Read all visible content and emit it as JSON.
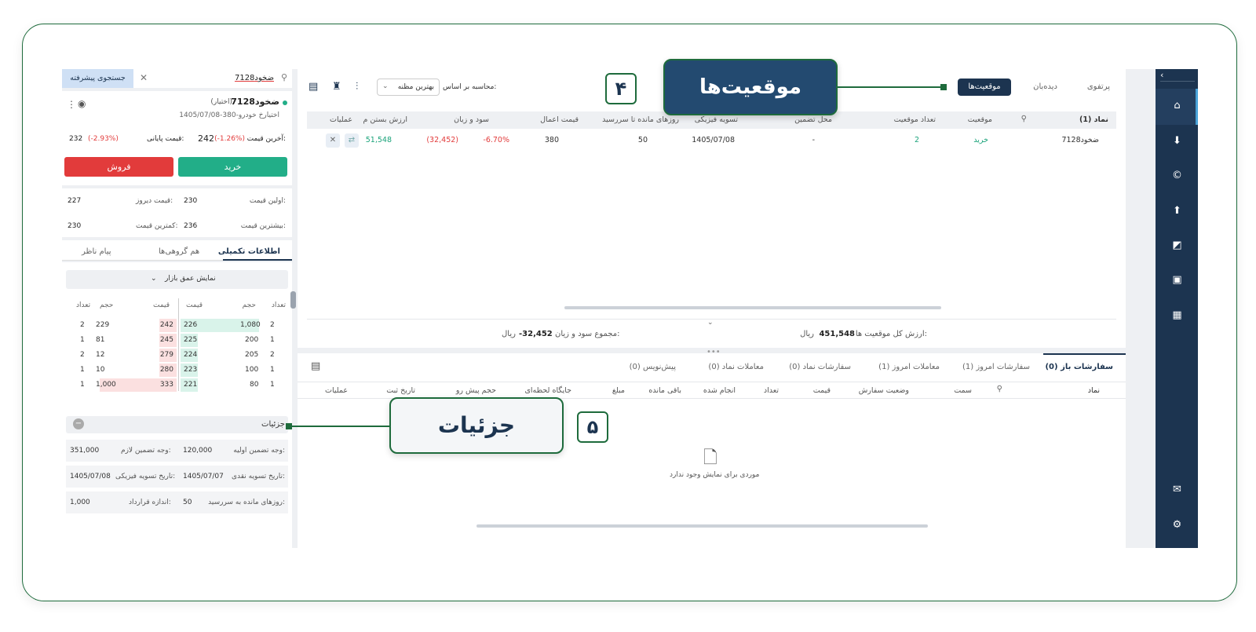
{
  "callouts": {
    "positions": {
      "number": "۴",
      "label": "موقعیت‌ها"
    },
    "details": {
      "number": "۵",
      "label": "جزئیات"
    }
  },
  "colors": {
    "rail": "#1c3450",
    "buy": "#22ae88",
    "sell": "#e23b3b",
    "accent": "#1e6b3c"
  },
  "left": {
    "advanced_search": "جستجوی پیشرفته",
    "search_value": "ضخود7128",
    "symbol": "ضخود7128",
    "symbol_type": "(اختیار)",
    "symbol_desc": "اختیارخ خودرو-380-1405/07/08",
    "last_price_label": "آخرین قیمت:",
    "last_price": "242",
    "last_price_change": "(-1.26%)",
    "close_price_label": "قیمت پایانی:",
    "close_price": "232",
    "close_price_change": "(-2.93%)",
    "buy": "خرید",
    "sell": "فروش",
    "first_price_label": "اولین قیمت:",
    "first_price": "230",
    "yesterday_price_label": "قیمت دیروز:",
    "yesterday_price": "227",
    "max_price_label": "بیشترین قیمت:",
    "max_price": "236",
    "min_price_label": "کمترین قیمت:",
    "min_price": "230",
    "tabs": [
      "اطلاعات تکمیلی",
      "هم گروهی‌ها",
      "پیام ناظر"
    ],
    "depth_toggle": "نمایش عمق بازار",
    "depth_headers": {
      "count": "تعداد",
      "volume": "حجم",
      "price": "قیمت"
    },
    "bids": [
      {
        "count": "2",
        "volume": "1,080",
        "price": "226"
      },
      {
        "count": "1",
        "volume": "200",
        "price": "225"
      },
      {
        "count": "2",
        "volume": "205",
        "price": "224"
      },
      {
        "count": "1",
        "volume": "100",
        "price": "223"
      },
      {
        "count": "1",
        "volume": "80",
        "price": "221"
      }
    ],
    "asks": [
      {
        "price": "242",
        "volume": "229",
        "count": "2"
      },
      {
        "price": "245",
        "volume": "81",
        "count": "1"
      },
      {
        "price": "279",
        "volume": "12",
        "count": "2"
      },
      {
        "price": "280",
        "volume": "10",
        "count": "1"
      },
      {
        "price": "333",
        "volume": "1,000",
        "count": "1"
      }
    ],
    "details_title": "جزئیات",
    "details": [
      {
        "l1": "وجه تضمین اولیه:",
        "v1": "120,000",
        "l2": "وجه تضمین لازم:",
        "v2": "351,000"
      },
      {
        "l1": "تاریخ تسویه نقدی:",
        "v1": "1405/07/07",
        "l2": "تاریخ تسویه فیزیکی:",
        "v2": "1405/07/08"
      },
      {
        "l1": "روزهای مانده به سررسید:",
        "v1": "50",
        "l2": "اندازه قرارداد:",
        "v2": "1,000"
      }
    ]
  },
  "positions": {
    "tabs": [
      "پرتفوی",
      "دیده‌بان",
      "موقعیت‌ها"
    ],
    "calc_label": "محاسبه بر اساس:",
    "calc_value": "بهترین مظنه",
    "headers": [
      "نماد (1)",
      "موقعیت",
      "تعداد موقعیت",
      "محل تضمین",
      "تسویه فیزیکی",
      "روزهای مانده تا سررسید",
      "قیمت اعمال",
      "سود و زیان",
      "ارزش بستن م",
      "عملیات"
    ],
    "rows": [
      {
        "symbol": "ضخود7128",
        "side": "خرید",
        "count": "2",
        "collateral": "-",
        "settle": "1405/07/08",
        "days": "50",
        "strike": "380",
        "pct": "-6.70%",
        "pnl": "(32,452)",
        "value": "51,548"
      }
    ],
    "total_value_label": "ارزش کل موقعیت ها:",
    "total_value": "451,548",
    "total_pnl_label": "مجموع سود و زیان:",
    "total_pnl": "-32,452",
    "currency": "ریال"
  },
  "orders": {
    "tabs": [
      "سفارشات باز (0)",
      "سفارشات امروز (1)",
      "معاملات امروز (1)",
      "سفارشات نماد (0)",
      "معاملات نماد (0)",
      "پیش‌نویس (0)"
    ],
    "headers": [
      "نماد",
      "سمت",
      "وضعیت سفارش",
      "قیمت",
      "تعداد",
      "انجام شده",
      "باقی مانده",
      "مبلغ",
      "جایگاه لحظه‌ای",
      "حجم پیش رو",
      "تاریخ ثبت",
      "عملیات"
    ],
    "empty": "موردی برای نمایش وجود ندارد"
  }
}
